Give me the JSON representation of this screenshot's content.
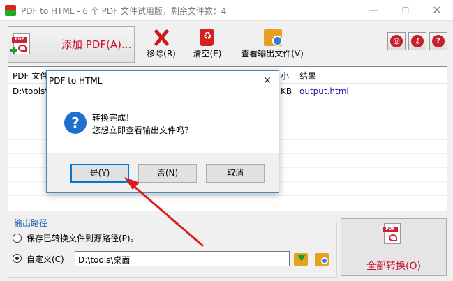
{
  "window": {
    "title": "PDF to HTML - 6 个 PDF 文件试用版，剩余文件数：4"
  },
  "toolbar": {
    "add_pdf": "添加 PDF(A)...",
    "remove": "移除(R)",
    "clear": "清空(E)",
    "view_output": "查看输出文件(V)"
  },
  "file_list": {
    "columns": [
      "PDF 文件",
      "小",
      "结果"
    ],
    "rows": [
      {
        "file": "D:\\tools\\...",
        "size": "KB",
        "result": "output.html"
      }
    ]
  },
  "output_path": {
    "title": "输出路径",
    "option_source": "保存已转换文件到源路径(P)。",
    "option_custom": "自定义(C)",
    "custom_path": "D:\\tools\\桌面"
  },
  "convert_all": "全部转换(O)",
  "dialog": {
    "title": "PDF to HTML",
    "line1": "转换完成！",
    "line2": "您想立即查看输出文件吗？",
    "yes": "是(Y)",
    "no": "否(N)",
    "cancel": "取消"
  },
  "icons": {
    "pdf_label": "PDF",
    "remove": "x-icon",
    "clear": "trash-icon",
    "view_output": "folder-search-icon",
    "right_buttons": [
      "globe-icon",
      "key-icon",
      "help-icon"
    ],
    "dialog": "question-icon"
  },
  "colors": {
    "accent_red": "#c8102e",
    "link_blue": "#1a1aa6",
    "dialog_border": "#3c8ac8",
    "annotation_arrow": "#d42020"
  }
}
